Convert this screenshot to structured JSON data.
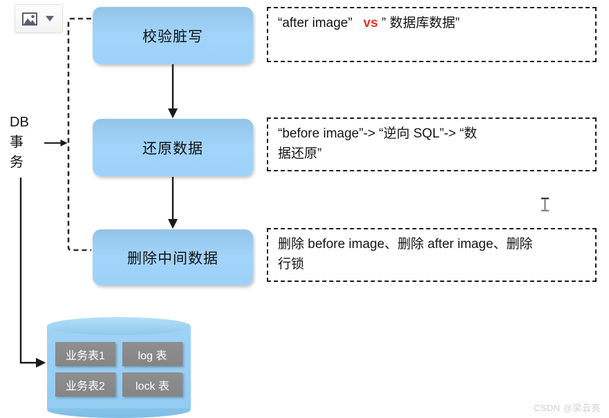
{
  "toolbar": {
    "picture_icon": "image-icon",
    "dropdown_icon": "chevron-down-icon",
    "picture_label": "",
    "dropdown_label": ""
  },
  "left_label": {
    "lines": [
      "DB",
      "事",
      "务"
    ]
  },
  "flow": {
    "steps": [
      {
        "label": "校验脏写"
      },
      {
        "label": "还原数据"
      },
      {
        "label": "删除中间数据"
      }
    ]
  },
  "notes": [
    {
      "id": "note-after-image",
      "pre": "“after image”",
      "vs": "vs",
      "post": "” 数据库数据”",
      "lines": []
    },
    {
      "id": "note-before-image",
      "lines": [
        "“before image”-> “逆向 SQL”-> “数",
        "据还原”"
      ]
    },
    {
      "id": "note-delete",
      "lines": [
        "删除 before image、删除 after image、删除",
        "行锁"
      ]
    }
  ],
  "database": {
    "tables": [
      "业务表1",
      "log 表",
      "业务表2",
      "lock 表"
    ]
  },
  "cursor": {
    "type": "text-caret"
  },
  "watermark": {
    "text": "CSDN @梁云亮"
  },
  "colors": {
    "box_fill_top": "#93c4e8",
    "box_fill_bottom": "#9ed2f8",
    "note_border": "#1b1b1b",
    "accent_red": "#e8332a",
    "table_chip": "#8b8b8b",
    "cylinder": "#9fd3f5",
    "background": "#ffffff"
  }
}
